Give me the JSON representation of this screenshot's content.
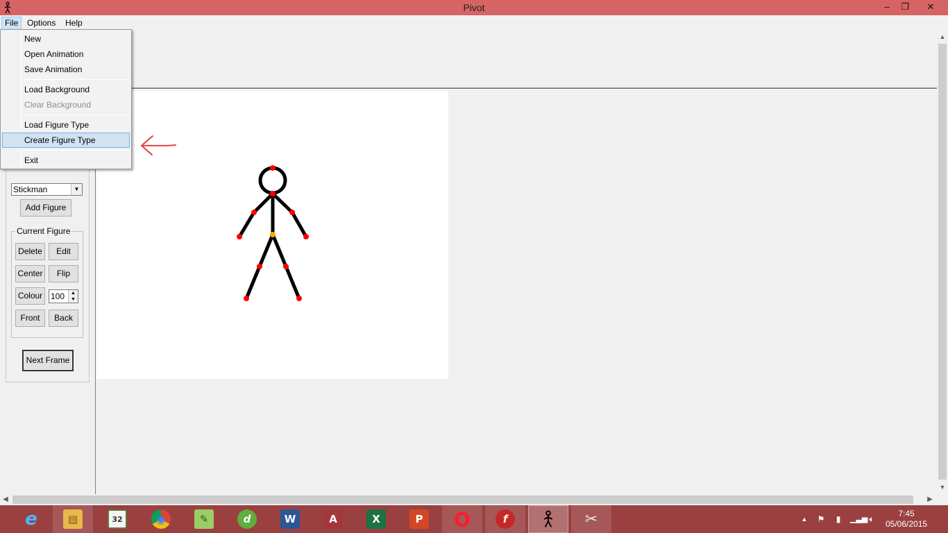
{
  "window": {
    "title": "Pivot",
    "minimize_glyph": "–",
    "restore_glyph": "❐",
    "close_glyph": "✕"
  },
  "menubar": {
    "items": [
      {
        "label": "File"
      },
      {
        "label": "Options"
      },
      {
        "label": "Help"
      }
    ]
  },
  "file_menu": {
    "items": [
      {
        "label": "New",
        "enabled": true
      },
      {
        "label": "Open Animation",
        "enabled": true
      },
      {
        "label": "Save Animation",
        "enabled": true
      },
      {
        "label": "Load Background",
        "enabled": true
      },
      {
        "label": "Clear Background",
        "enabled": false
      },
      {
        "label": "Load Figure Type",
        "enabled": true
      },
      {
        "label": "Create Figure Type",
        "enabled": true,
        "highlighted": true
      },
      {
        "label": "Exit",
        "enabled": true
      }
    ]
  },
  "left_panel": {
    "figure_type_select": {
      "value": "Stickman"
    },
    "add_figure_label": "Add Figure",
    "current_figure": {
      "title": "Current Figure",
      "delete_label": "Delete",
      "edit_label": "Edit",
      "center_label": "Center",
      "flip_label": "Flip",
      "colour_label": "Colour",
      "size_value": "100",
      "front_label": "Front",
      "back_label": "Back"
    },
    "next_frame_label": "Next Frame"
  },
  "canvas": {
    "background": "#ffffff",
    "figure": {
      "type": "stickman",
      "limb_color": "#000000",
      "joint_color": "#ff0000",
      "root_joint_color": "#ffa500"
    }
  },
  "annotation": {
    "arrow_color": "#e04040"
  },
  "taskbar": {
    "apps": [
      {
        "name": "internet-explorer",
        "glyph": "e",
        "color": "#1e8fdc"
      },
      {
        "name": "file-explorer",
        "glyph": "▤",
        "color": "#e8b84a"
      },
      {
        "name": "calendar-app",
        "glyph": "32",
        "color": "#5a7a3a"
      },
      {
        "name": "chrome",
        "glyph": "◉",
        "color": "#d8443a"
      },
      {
        "name": "notepad-plus",
        "glyph": "✎",
        "color": "#7cb342"
      },
      {
        "name": "dreamweaver",
        "glyph": "d",
        "color": "#5fae3e"
      },
      {
        "name": "word",
        "glyph": "W",
        "color": "#2b5797"
      },
      {
        "name": "access",
        "glyph": "A",
        "color": "#a4373a"
      },
      {
        "name": "excel",
        "glyph": "X",
        "color": "#1e7145"
      },
      {
        "name": "powerpoint",
        "glyph": "P",
        "color": "#d24726"
      },
      {
        "name": "opera",
        "glyph": "O",
        "color": "#cc0f16"
      },
      {
        "name": "flash",
        "glyph": "f",
        "color": "#c62828"
      },
      {
        "name": "pivot",
        "glyph": "웃",
        "color": "#9a4040"
      },
      {
        "name": "snipping-tool",
        "glyph": "✂",
        "color": "#8a8aa0"
      }
    ],
    "clock": {
      "time": "7:45",
      "date": "05/06/2015"
    },
    "colors": {
      "taskbar": "#9a4040",
      "titlebar": "#d76464"
    }
  }
}
